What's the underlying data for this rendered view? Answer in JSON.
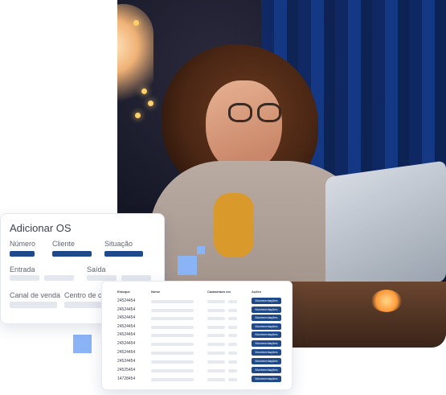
{
  "order_card": {
    "title": "Adicionar OS",
    "fields": {
      "numero": "Número",
      "cliente": "Cliente",
      "situacao": "Situação",
      "entrada": "Entrada",
      "saida": "Saída",
      "canal": "Canal de venda",
      "centro": "Centro de cu"
    }
  },
  "table_card": {
    "headers": [
      "Estoque",
      "Nome",
      "Cadastrado em",
      "Ações"
    ],
    "rows": [
      {
        "code": "24524454",
        "action": "Movimentações"
      },
      {
        "code": "24524454",
        "action": "Movimentações"
      },
      {
        "code": "24524454",
        "action": "Movimentações"
      },
      {
        "code": "24524454",
        "action": "Movimentações"
      },
      {
        "code": "24524454",
        "action": "Movimentações"
      },
      {
        "code": "24524454",
        "action": "Movimentações"
      },
      {
        "code": "24524454",
        "action": "Movimentações"
      },
      {
        "code": "24524454",
        "action": "Movimentações"
      },
      {
        "code": "24525454",
        "action": "Movimentações"
      },
      {
        "code": "14728454",
        "action": "Movimentações"
      }
    ]
  },
  "colors": {
    "accent": "#1e4a8c",
    "placeholder": "#e4e7ed",
    "decor_square": "#8bb4f7"
  }
}
